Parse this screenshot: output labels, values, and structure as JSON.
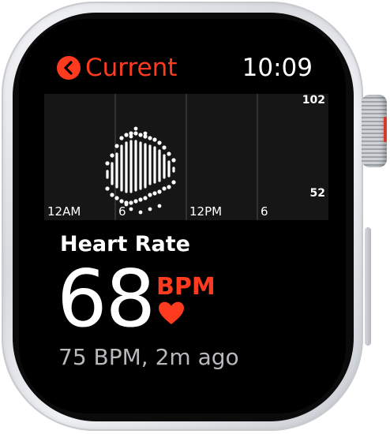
{
  "header": {
    "back_label": "Current",
    "time": "10:09"
  },
  "chart_data": {
    "type": "scatter",
    "x_tick_labels": [
      "12AM",
      "6",
      "12PM",
      "6"
    ],
    "y_tick_labels": [
      "102",
      "52"
    ],
    "ylim": [
      52,
      102
    ],
    "series_color": "#ffffff",
    "grid": true
  },
  "reading": {
    "title": "Heart Rate",
    "value": "68",
    "unit": "BPM",
    "recent": "75 BPM, 2m ago"
  },
  "colors": {
    "accent": "#ff3b1f",
    "background": "#000000",
    "text": "#ffffff",
    "secondary": "#b8b8bd"
  },
  "icons": {
    "back": "chevron-left-icon",
    "heart": "heart-icon"
  }
}
